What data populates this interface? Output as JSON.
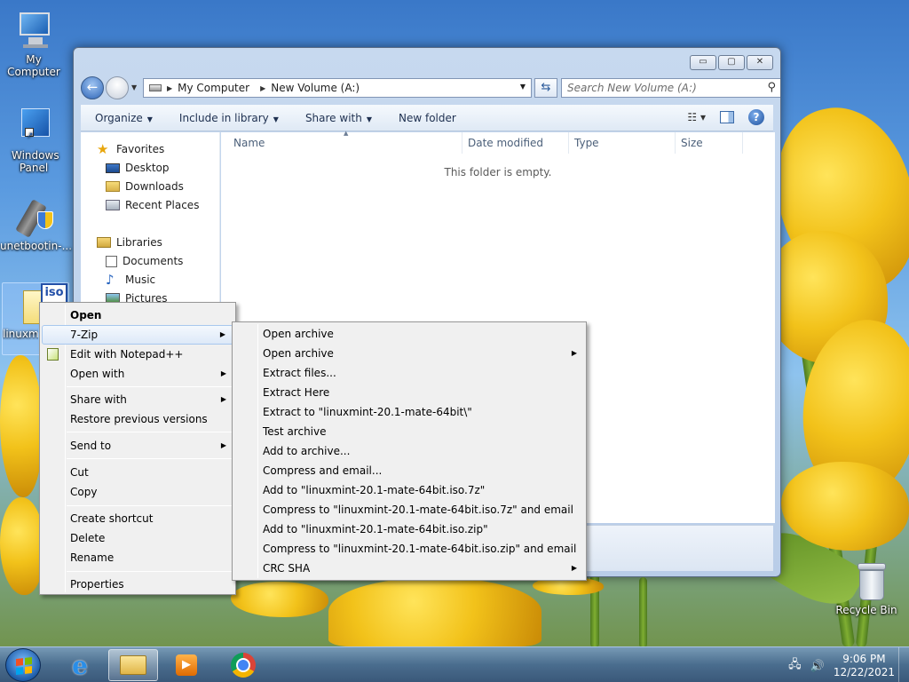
{
  "desktop": {
    "icons": [
      {
        "label": "My Computer",
        "icon": "computer-icon"
      },
      {
        "label": "Windows Panel",
        "icon": "control-panel-icon"
      },
      {
        "label": "unetbootin-...",
        "icon": "usb-installer-icon"
      },
      {
        "label": "linuxmint-20.1-mate-...",
        "icon": "iso-file-icon"
      },
      {
        "label": "Recycle Bin",
        "icon": "recycle-bin-icon"
      }
    ]
  },
  "explorer": {
    "window_buttons": {
      "minimize": "▭",
      "maximize": "▢",
      "close": "✕"
    },
    "address": {
      "crumb1": "My Computer",
      "crumb2": "New Volume (A:)"
    },
    "search_placeholder": "Search New Volume (A:)",
    "toolbar": {
      "organize": "Organize",
      "include": "Include in library",
      "share": "Share with",
      "new_folder": "New folder"
    },
    "nav": {
      "favorites": "Favorites",
      "desktop": "Desktop",
      "downloads": "Downloads",
      "recent": "Recent Places",
      "libraries": "Libraries",
      "documents": "Documents",
      "music": "Music",
      "pictures": "Pictures"
    },
    "columns": {
      "name": "Name",
      "date": "Date modified",
      "type": "Type",
      "size": "Size"
    },
    "empty_text": "This folder is empty."
  },
  "context_menu": {
    "open": "Open",
    "sevenzip": "7-Zip",
    "notepad": "Edit with Notepad++",
    "open_with": "Open with",
    "share_with": "Share with",
    "restore": "Restore previous versions",
    "send_to": "Send to",
    "cut": "Cut",
    "copy": "Copy",
    "create_shortcut": "Create shortcut",
    "delete": "Delete",
    "rename": "Rename",
    "properties": "Properties"
  },
  "zip_menu": {
    "items": [
      "Open archive",
      "Open archive",
      "Extract files...",
      "Extract Here",
      "Extract to \"linuxmint-20.1-mate-64bit\\\"",
      "Test archive",
      "Add to archive...",
      "Compress and email...",
      "Add to \"linuxmint-20.1-mate-64bit.iso.7z\"",
      "Compress to \"linuxmint-20.1-mate-64bit.iso.7z\" and email",
      "Add to \"linuxmint-20.1-mate-64bit.iso.zip\"",
      "Compress to \"linuxmint-20.1-mate-64bit.iso.zip\" and email",
      "CRC SHA"
    ]
  },
  "taskbar": {
    "time": "9:06 PM",
    "date": "12/22/2021"
  },
  "colors": {
    "accent": "#3a78c8",
    "menu_bg": "#f0f0f0",
    "taskbar": "#466996"
  }
}
